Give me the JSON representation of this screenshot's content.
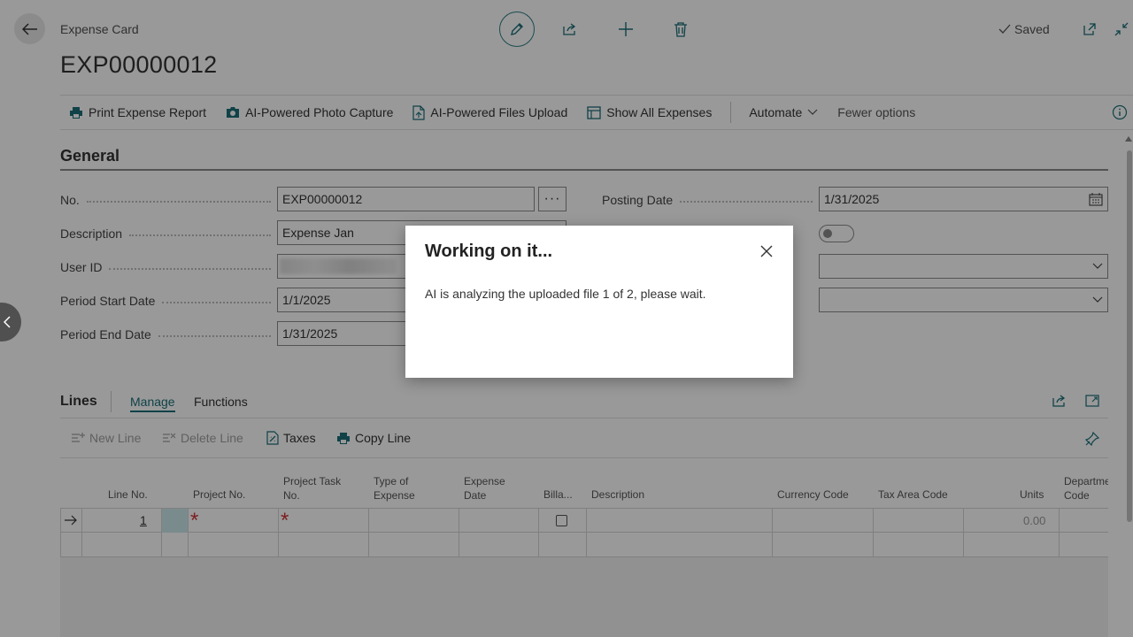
{
  "header": {
    "breadcrumb": "Expense Card",
    "title": "EXP00000012",
    "saved_label": "Saved"
  },
  "actions": [
    {
      "label": "Print Expense Report",
      "icon": "printer-icon"
    },
    {
      "label": "AI-Powered Photo Capture",
      "icon": "camera-icon"
    },
    {
      "label": "AI-Powered Files Upload",
      "icon": "file-upload-icon"
    },
    {
      "label": "Show All Expenses",
      "icon": "list-icon"
    }
  ],
  "actions_extra": {
    "automate": "Automate",
    "fewer": "Fewer options"
  },
  "general": {
    "section_title": "General",
    "no_label": "No.",
    "no_value": "EXP00000012",
    "description_label": "Description",
    "description_value": "Expense Jan",
    "user_label": "User ID",
    "period_start_label": "Period Start Date",
    "period_start_value": "1/1/2025",
    "period_end_label": "Period End Date",
    "period_end_value": "1/31/2025",
    "posting_label": "Posting Date",
    "posting_value": "1/31/2025"
  },
  "lines": {
    "title": "Lines",
    "tab_manage": "Manage",
    "tab_functions": "Functions",
    "actions": {
      "new_line": "New Line",
      "delete_line": "Delete Line",
      "taxes": "Taxes",
      "copy_line": "Copy Line"
    },
    "columns": {
      "line_no": "Line No.",
      "project_no": "Project No.",
      "project_task_1": "Project Task",
      "project_task_2": "No.",
      "type_1": "Type of",
      "type_2": "Expense",
      "date_1": "Expense",
      "date_2": "Date",
      "billable": "Billa...",
      "description": "Description",
      "currency": "Currency Code",
      "tax_area": "Tax Area Code",
      "units": "Units",
      "dept_1": "Departme",
      "dept_2": "Code"
    },
    "row": {
      "line_no": "1",
      "required_mark": "*",
      "units": "0.00"
    }
  },
  "dialog": {
    "title": "Working on it...",
    "message": "AI is analyzing the uploaded file 1 of 2, please wait."
  },
  "colors": {
    "accent": "#00838f",
    "required": "#d13438",
    "selected_cell": "#cce8ec"
  }
}
